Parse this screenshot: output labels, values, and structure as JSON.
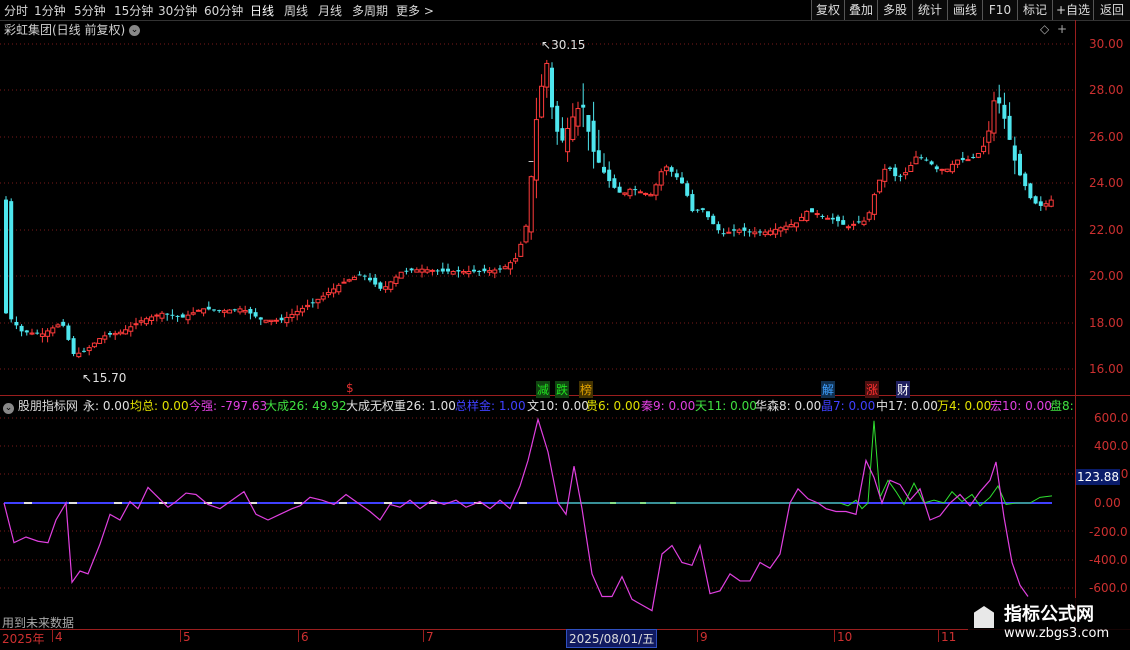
{
  "toolbar": {
    "timeframes": [
      "分时",
      "1分钟",
      "5分钟",
      "15分钟",
      "30分钟",
      "60分钟",
      "日线",
      "周线",
      "月线",
      "多周期",
      "更多 >"
    ],
    "active": "日线",
    "right_buttons": [
      "复权",
      "叠加",
      "多股",
      "统计",
      "画线",
      "F10",
      "标记",
      "+自选",
      "返回"
    ]
  },
  "stock": {
    "title": "彩虹集团(日线 前复权)"
  },
  "price_axis": {
    "labels": [
      "30.00",
      "28.00",
      "26.00",
      "24.00",
      "22.00",
      "20.00",
      "18.00",
      "16.00"
    ],
    "color": "#cc3030"
  },
  "annotations": {
    "high": "30.15",
    "low": "15.70"
  },
  "signals": [
    {
      "text": "$",
      "color": "#e03030"
    },
    {
      "text": "减",
      "color": "#20c020"
    },
    {
      "text": "跌",
      "color": "#20c020"
    },
    {
      "text": "榜",
      "color": "#e0a000"
    },
    {
      "text": "解",
      "color": "#40a0ff"
    },
    {
      "text": "涨",
      "color": "#ff3030"
    },
    {
      "text": "财",
      "color": "#ffffff"
    }
  ],
  "indicator": {
    "name": "股朋指标网",
    "values": [
      {
        "text": "永: 0.00",
        "color": "#e0e0e0"
      },
      {
        "text": "均总: 0.00",
        "color": "#e0e000"
      },
      {
        "text": "今强: -797.63",
        "color": "#e040e0"
      },
      {
        "text": "大成26: 49.92",
        "color": "#40e040"
      },
      {
        "text": "大成无权重26: 1.00",
        "color": "#e0e0e0"
      },
      {
        "text": "总样金: 1.00",
        "color": "#4040ff"
      },
      {
        "text": "文10: 0.00",
        "color": "#e0e0e0"
      },
      {
        "text": "贵6: 0.00",
        "color": "#e0e000"
      },
      {
        "text": "秦9: 0.00",
        "color": "#e040e0"
      },
      {
        "text": "天11: 0.00",
        "color": "#40e040"
      },
      {
        "text": "华森8: 0.00",
        "color": "#e0e0e0"
      },
      {
        "text": "晶7: 0.00",
        "color": "#4040ff"
      },
      {
        "text": "中17: 0.00",
        "color": "#e0e0e0"
      },
      {
        "text": "万4: 0.00",
        "color": "#e0e000"
      },
      {
        "text": "宏10: 0.00",
        "color": "#e040e0"
      },
      {
        "text": "盘8:",
        "color": "#40e040"
      }
    ],
    "axis_labels": [
      "600.0",
      "400.0",
      "200.0",
      "0.00",
      "-200.0",
      "-400.0",
      "-600.0"
    ],
    "current_value": "123.88"
  },
  "footer": {
    "future_note": "用到未来数据"
  },
  "date_axis": {
    "year": "2025年",
    "months": [
      "4",
      "5",
      "6",
      "7",
      "9",
      "10",
      "11"
    ],
    "cursor_date": "2025/08/01/五"
  },
  "watermark": {
    "line1": "指标公式网",
    "line2": "www.zbgs3.com"
  },
  "colors": {
    "up": "#ff3b3b",
    "down": "#4ee6ee",
    "grid": "#9a1e1e",
    "indicator_main": "#e040e0",
    "indicator_green": "#30e030",
    "baseline": "#4040ff"
  }
}
